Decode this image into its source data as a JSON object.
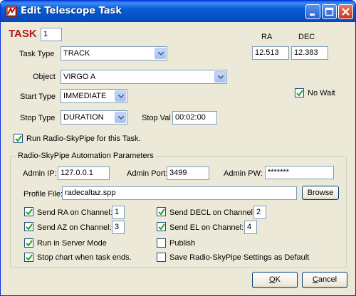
{
  "window": {
    "title": "Edit Telescope Task"
  },
  "task": {
    "label": "TASK",
    "number": "1"
  },
  "coords": {
    "ra_label": "RA",
    "dec_label": "DEC",
    "ra_value": "12.513",
    "dec_value": "12.383"
  },
  "task_type": {
    "label": "Task Type",
    "value": "TRACK"
  },
  "object": {
    "label": "Object",
    "value": "VIRGO A"
  },
  "start_type": {
    "label": "Start Type",
    "value": "IMMEDIATE"
  },
  "stop_type": {
    "label": "Stop Type",
    "value": "DURATION"
  },
  "stop_val": {
    "label": "Stop Val",
    "value": "00:02:00"
  },
  "no_wait": {
    "label": "No Wait",
    "checked": true
  },
  "run_skypipe": {
    "label": "Run Radio-SkyPipe for this Task.",
    "checked": true
  },
  "automation": {
    "group_label": "Radio-SkyPipe Automation Parameters",
    "admin_ip_label": "Admin IP:",
    "admin_ip": "127.0.0.1",
    "admin_port_label": "Admin Port:",
    "admin_port": "3499",
    "admin_pw_label": "Admin PW:",
    "admin_pw": "*******",
    "profile_label": "Profile File:",
    "profile_value": "radecaltaz.spp",
    "browse_label": "Browse",
    "send_ra": {
      "label": "Send RA on Channel:",
      "channel": "1",
      "checked": true
    },
    "send_az": {
      "label": "Send AZ on Channel:",
      "channel": "3",
      "checked": true
    },
    "send_decl": {
      "label": "Send DECL on Channel:",
      "channel": "2",
      "checked": true
    },
    "send_el": {
      "label": "Send EL on Channel:",
      "channel": "4",
      "checked": true
    },
    "server_mode": {
      "label": "Run in Server Mode",
      "checked": true
    },
    "stop_chart": {
      "label": "Stop chart when task ends.",
      "checked": true
    },
    "publish": {
      "label": "Publish",
      "checked": false
    },
    "save_default": {
      "label": "Save Radio-SkyPipe Settings as Default",
      "checked": false
    }
  },
  "buttons": {
    "ok_rest": "K",
    "ok_mnemonic": "O",
    "cancel_mnemonic": "C",
    "cancel_rest": "ancel"
  }
}
